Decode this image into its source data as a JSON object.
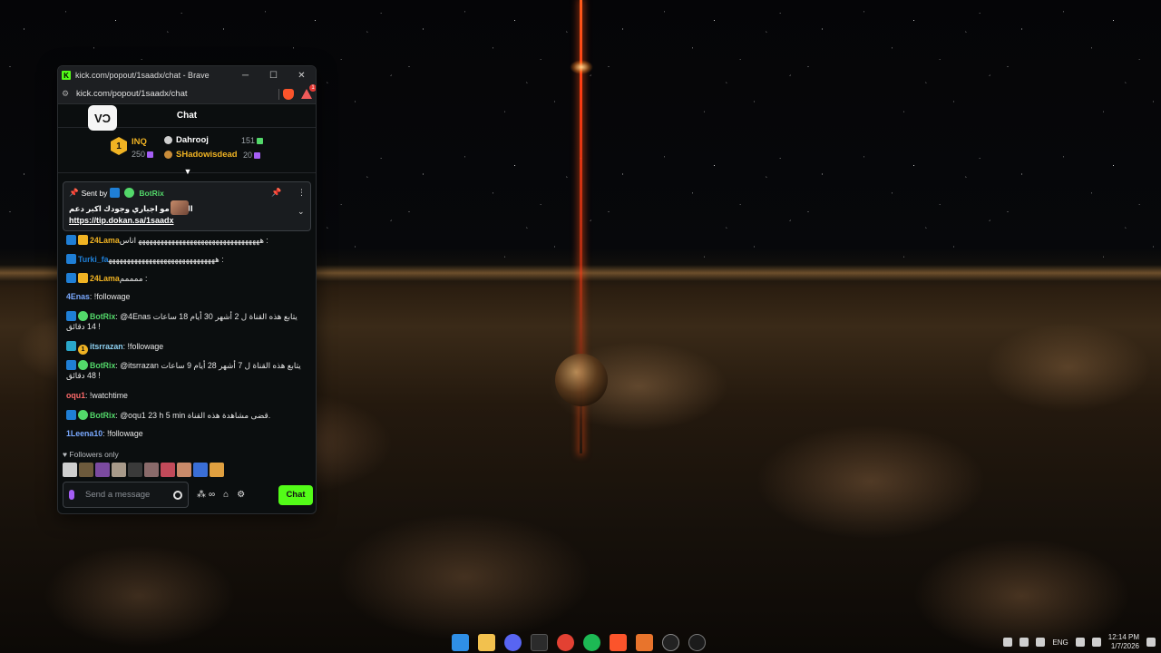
{
  "window": {
    "title": "kick.com/popout/1saadx/chat - Brave",
    "url": "kick.com/popout/1saadx/chat",
    "minimize": "─",
    "maximize": "☐",
    "close": "✕"
  },
  "chat": {
    "header_title": "Chat",
    "channel_icon_text": "VƆ",
    "leaderboard": {
      "rank1": {
        "rank": "1",
        "name": "INQ",
        "count": "250"
      },
      "entries": [
        {
          "name": "Dahrooj",
          "count": "151",
          "color": "#ffffff"
        },
        {
          "name": "SHadowisdead",
          "count": "20",
          "color": "#f0b323"
        }
      ]
    },
    "pinned": {
      "sent_by_label": "Sent by",
      "sender": "BotRix",
      "message": "الدعم مو اجباري وجودك اكبر دعم",
      "link": "https://tip.dokan.sa/1saadx",
      "pin_icon": "📌",
      "more_icon": "⋮",
      "expand_icon": "⌄"
    },
    "messages": [
      {
        "user": "24Lama",
        "user_color": "#f0b323",
        "text": ": ﻫﻬﻬﻬﻬﻬﻬﻬﻬﻬﻬﻬﻬﻬﻬﻬﻬﻬﻬﻬﻬﻬﻬﻬﻬﻬﻬﻬﻬﻬﻬﻬﻬﻬ اناس"
      },
      {
        "user": "Turki_fa",
        "user_color": "#1f7fd6",
        "text": ": ﻫﻬﻬﻬﻬﻬﻬﻬﻬﻬﻬﻬﻬﻬﻬﻬﻬﻬﻬﻬﻬﻬﻬﻬﻬﻬﻬﻬﻬﻬ"
      },
      {
        "user": "24Lama",
        "user_color": "#f0b323",
        "text": ": ممممم"
      },
      {
        "user": "4Enas",
        "user_color": "#7aa9ff",
        "text": ": !followage"
      },
      {
        "user": "BotRix",
        "user_color": "#53d86a",
        "text": ": @4Enas يتابع هذه القناة ل 2 أشهر 30 أيام 18 ساعات 14 دقائق !"
      },
      {
        "user": "itsrrazan",
        "user_color": "#8fd3f4",
        "text": ": !followage"
      },
      {
        "user": "BotRix",
        "user_color": "#53d86a",
        "text": ": @itsrrazan يتابع هذه القناة ل 7 أشهر 28 أيام 9 ساعات 48 دقائق !"
      },
      {
        "user": "oqu1",
        "user_color": "#ff6b6b",
        "text": ": !watchtime"
      },
      {
        "user": "BotRix",
        "user_color": "#53d86a",
        "text": ": @oqu1 23 h 5 min قضى مشاهدة هذه القناة."
      },
      {
        "user": "1Leena10",
        "user_color": "#7aa9ff",
        "text": ": !followage"
      }
    ],
    "followers_only_label": "Followers only",
    "input_placeholder": "Send a message",
    "send_button": "Chat"
  },
  "taskbar": {
    "language": "ENG",
    "time": "12:14 PM",
    "date": "1/7/2026"
  }
}
